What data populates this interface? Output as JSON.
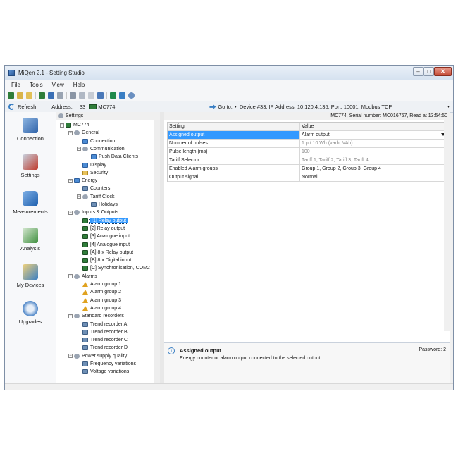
{
  "window": {
    "title": "MiQen 2.1 - Setting Studio"
  },
  "menu": [
    "File",
    "Tools",
    "View",
    "Help"
  ],
  "address_bar": {
    "refresh_label": "Refresh",
    "address_label": "Address:",
    "address_value": "33",
    "device_name": "MC774",
    "goto_label": "Go to:",
    "goto_value": "Device #33, IP Address: 10.120.4.135, Port: 10001, Modbus TCP"
  },
  "nav": [
    {
      "label": "Connection",
      "icon": "connection-icon"
    },
    {
      "label": "Settings",
      "icon": "settings-icon"
    },
    {
      "label": "Measurements",
      "icon": "measurements-icon"
    },
    {
      "label": "Analysis",
      "icon": "analysis-icon"
    },
    {
      "label": "My Devices",
      "icon": "my-devices-icon"
    },
    {
      "label": "Upgrades",
      "icon": "upgrades-icon"
    }
  ],
  "tree": {
    "header": "Settings",
    "nodes": [
      {
        "label": "MC774",
        "level": 0,
        "icon": "device-icon",
        "expander": "−"
      },
      {
        "label": "General",
        "level": 1,
        "icon": "general-icon",
        "expander": "−"
      },
      {
        "label": "Connection",
        "level": 2,
        "icon": "connection-icon",
        "expander": ""
      },
      {
        "label": "Communication",
        "level": 2,
        "icon": "communication-icon",
        "expander": "−"
      },
      {
        "label": "Push Data Clients",
        "level": 3,
        "icon": "push-data-icon",
        "expander": ""
      },
      {
        "label": "Display",
        "level": 2,
        "icon": "display-icon",
        "expander": ""
      },
      {
        "label": "Security",
        "level": 2,
        "icon": "lock-icon",
        "expander": ""
      },
      {
        "label": "Energy",
        "level": 1,
        "icon": "energy-icon",
        "expander": "−"
      },
      {
        "label": "Counters",
        "level": 2,
        "icon": "counter-icon",
        "expander": ""
      },
      {
        "label": "Tariff Clock",
        "level": 2,
        "icon": "clock-icon",
        "expander": "−"
      },
      {
        "label": "Holidays",
        "level": 3,
        "icon": "calendar-icon",
        "expander": ""
      },
      {
        "label": "Inputs & Outputs",
        "level": 1,
        "icon": "io-icon",
        "expander": "−"
      },
      {
        "label": "[1] Relay output",
        "level": 2,
        "icon": "relay-icon",
        "expander": "",
        "selected": true
      },
      {
        "label": "[2] Relay output",
        "level": 2,
        "icon": "relay-icon",
        "expander": ""
      },
      {
        "label": "[3] Analogue input",
        "level": 2,
        "icon": "analogue-icon",
        "expander": ""
      },
      {
        "label": "[4] Analogue input",
        "level": 2,
        "icon": "analogue-icon",
        "expander": ""
      },
      {
        "label": "[A] 8 x Relay output",
        "level": 2,
        "icon": "relay-icon",
        "expander": ""
      },
      {
        "label": "[B] 8 x Digital input",
        "level": 2,
        "icon": "digital-icon",
        "expander": ""
      },
      {
        "label": "[C] Synchronisation, COM2",
        "level": 2,
        "icon": "sync-icon",
        "expander": ""
      },
      {
        "label": "Alarms",
        "level": 1,
        "icon": "alarms-icon",
        "expander": "−"
      },
      {
        "label": "Alarm group 1",
        "level": 2,
        "icon": "alarm-icon",
        "expander": ""
      },
      {
        "label": "Alarm group 2",
        "level": 2,
        "icon": "alarm-icon",
        "expander": ""
      },
      {
        "label": "Alarm group 3",
        "level": 2,
        "icon": "alarm-icon",
        "expander": ""
      },
      {
        "label": "Alarm group 4",
        "level": 2,
        "icon": "alarm-icon",
        "expander": ""
      },
      {
        "label": "Standard recorders",
        "level": 1,
        "icon": "recorders-icon",
        "expander": "−"
      },
      {
        "label": "Trend recorder A",
        "level": 2,
        "icon": "trend-icon",
        "expander": ""
      },
      {
        "label": "Trend recorder B",
        "level": 2,
        "icon": "trend-icon",
        "expander": ""
      },
      {
        "label": "Trend recorder C",
        "level": 2,
        "icon": "trend-icon",
        "expander": ""
      },
      {
        "label": "Trend recorder D",
        "level": 2,
        "icon": "trend-icon",
        "expander": ""
      },
      {
        "label": "Power supply quality",
        "level": 1,
        "icon": "quality-icon",
        "expander": "−"
      },
      {
        "label": "Frequency variations",
        "level": 2,
        "icon": "frequency-icon",
        "expander": ""
      },
      {
        "label": "Voltage variations",
        "level": 2,
        "icon": "voltage-icon",
        "expander": ""
      }
    ]
  },
  "main": {
    "header": "MC774, Serial number: MC016767, Read at 13:54:50",
    "columns": [
      "Setting",
      "Value"
    ],
    "rows": [
      {
        "setting": "Assigned output",
        "value": "Alarm output",
        "selected": true,
        "dropdown": true,
        "disabled": false
      },
      {
        "setting": "Number of pulses",
        "value": "1 p / 10 Wh  (varh, VAh)",
        "selected": false,
        "dropdown": false,
        "disabled": true
      },
      {
        "setting": "Pulse length (ms)",
        "value": "100",
        "selected": false,
        "dropdown": false,
        "disabled": true
      },
      {
        "setting": "Tariff Selector",
        "value": "Tariff 1, Tariff 2, Tariff 3, Tariff 4",
        "selected": false,
        "dropdown": false,
        "disabled": true
      },
      {
        "setting": "Enabled Alarm groups",
        "value": "Group 1, Group 2, Group 3, Group 4",
        "selected": false,
        "dropdown": false,
        "disabled": false
      },
      {
        "setting": "Output signal",
        "value": "Normal",
        "selected": false,
        "dropdown": false,
        "disabled": false
      }
    ]
  },
  "help": {
    "title": "Assigned output",
    "description": "Energy counter or alarm output connected to the selected output.",
    "password": "Password: 2"
  },
  "colors": {
    "selection": "#3399ff",
    "window_border": "#7e8fa6"
  }
}
